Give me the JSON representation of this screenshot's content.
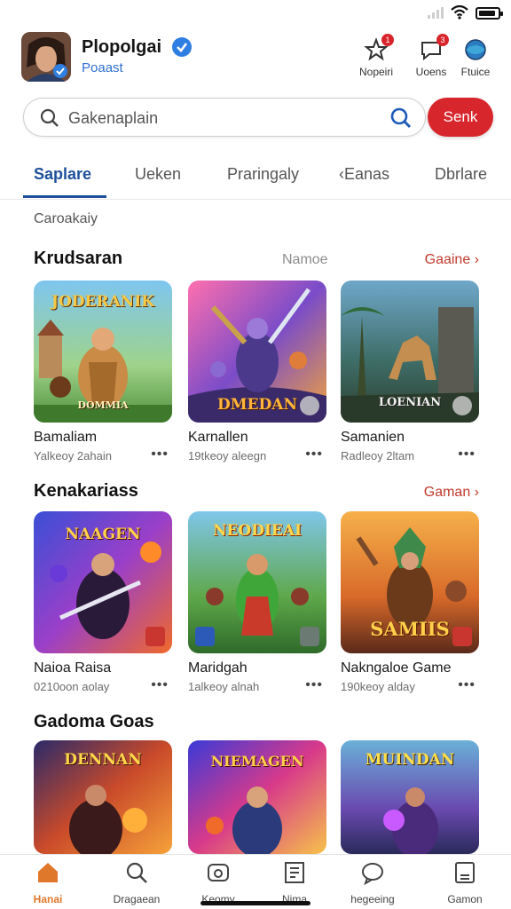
{
  "header": {
    "app_name": "Plopolgai",
    "subtitle": "Poaast",
    "buttons": [
      {
        "label": "Nopeiri",
        "icon": "star-icon",
        "badge": "1"
      },
      {
        "label": "Uoens",
        "icon": "chat-icon",
        "badge": "3"
      },
      {
        "label": "Ftuice",
        "icon": "globe-icon",
        "badge": ""
      }
    ]
  },
  "search": {
    "placeholder": "Gakenaplain",
    "button_label": "Senk"
  },
  "tabs": [
    {
      "label": "Saplare",
      "active": true
    },
    {
      "label": "Ueken",
      "active": false
    },
    {
      "label": "Praringaly",
      "active": false
    },
    {
      "label": "‹Eanas",
      "active": false
    },
    {
      "label": "Dbrlare",
      "active": false
    }
  ],
  "category_label": "Caroakaiy",
  "sections": [
    {
      "title": "Krudsaran",
      "mid_label": "Namoe",
      "more_label": "Gaaine ›",
      "items": [
        {
          "name": "Bamaliam",
          "meta": "Yalkeoy 2ahain",
          "art_title": "JODERANIK",
          "art_sub": "DOMMIA"
        },
        {
          "name": "Karnallen",
          "meta": "19tkeoy aleegn",
          "art_title": "DMEDAN",
          "art_sub": ""
        },
        {
          "name": "Samanien",
          "meta": "Radleoy 2ltam",
          "art_title": "LOENIAN",
          "art_sub": ""
        }
      ]
    },
    {
      "title": "Kenakariass",
      "mid_label": "",
      "more_label": "Gaman ›",
      "items": [
        {
          "name": "Naioa Raisa",
          "meta": "0210oon aolay",
          "art_title": "NAAGEN",
          "art_sub": ""
        },
        {
          "name": "Maridgah",
          "meta": "1alkeoy alnah",
          "art_title": "NEODIEAI",
          "art_sub": ""
        },
        {
          "name": "Nakngaloe Game",
          "meta": "190keoy alday",
          "art_title": "SAMIIS",
          "art_sub": ""
        }
      ]
    },
    {
      "title": "Gadoma Goas",
      "mid_label": "",
      "more_label": "",
      "items": [
        {
          "name": "",
          "meta": "",
          "art_title": "DENNAN",
          "art_sub": ""
        },
        {
          "name": "",
          "meta": "",
          "art_title": "NIEMAGEN",
          "art_sub": ""
        },
        {
          "name": "",
          "meta": "",
          "art_title": "MUINDAN",
          "art_sub": ""
        }
      ]
    }
  ],
  "bottom_nav": [
    {
      "label": "Hanai",
      "icon": "home-icon",
      "active": true
    },
    {
      "label": "Dragaean",
      "icon": "search-icon",
      "active": false
    },
    {
      "label": "Keomy",
      "icon": "controller-icon",
      "active": false
    },
    {
      "label": "Nima",
      "icon": "library-icon",
      "active": false
    },
    {
      "label": "hegeeing",
      "icon": "chat-bubble-icon",
      "active": false
    },
    {
      "label": "Gamon",
      "icon": "profile-card-icon",
      "active": false
    }
  ],
  "colors": {
    "accent_blue": "#1d4f9a",
    "accent_red": "#d8262d",
    "active_nav": "#e0782b",
    "more_link": "#c0392b"
  }
}
